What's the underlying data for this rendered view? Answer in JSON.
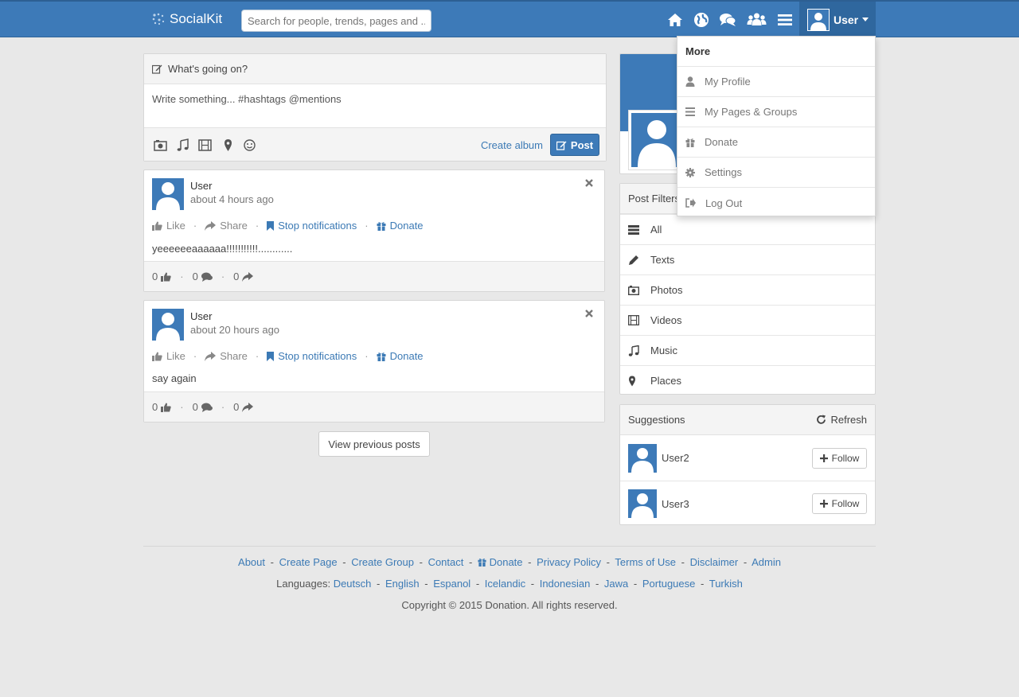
{
  "header": {
    "logo_text": "SocialKit",
    "search_placeholder": "Search for people, trends, pages and ...",
    "user_label": "User",
    "brand_color": "#3d7ab8"
  },
  "user_menu": {
    "title": "More",
    "items": [
      {
        "label": "My Profile",
        "icon": "user-icon"
      },
      {
        "label": "My Pages & Groups",
        "icon": "list-icon"
      },
      {
        "label": "Donate",
        "icon": "gift-icon"
      },
      {
        "label": "Settings",
        "icon": "gear-icon"
      },
      {
        "label": "Log Out",
        "icon": "logout-icon"
      }
    ]
  },
  "composer": {
    "title": "What's going on?",
    "placeholder": "Write something... #hashtags @mentions",
    "create_album": "Create album",
    "post_button": "Post"
  },
  "posts": [
    {
      "name": "User",
      "time": "about 4 hours ago",
      "text": "yeeeeeeaaaaaa!!!!!!!!!!!............",
      "likes": "0",
      "comments": "0",
      "shares": "0"
    },
    {
      "name": "User",
      "time": "about 20 hours ago",
      "text": "say again",
      "likes": "0",
      "comments": "0",
      "shares": "0"
    }
  ],
  "post_actions": {
    "like": "Like",
    "share": "Share",
    "stop_notifications": "Stop notifications",
    "donate": "Donate",
    "separator": "·"
  },
  "view_previous": "View previous posts",
  "filters": {
    "title": "Post Filters",
    "items": [
      {
        "label": "All",
        "icon": "stack-icon"
      },
      {
        "label": "Texts",
        "icon": "pencil-icon"
      },
      {
        "label": "Photos",
        "icon": "camera-icon"
      },
      {
        "label": "Videos",
        "icon": "film-icon"
      },
      {
        "label": "Music",
        "icon": "music-icon"
      },
      {
        "label": "Places",
        "icon": "map-marker-icon"
      }
    ]
  },
  "suggestions": {
    "title": "Suggestions",
    "refresh": "Refresh",
    "follow_label": "Follow",
    "users": [
      "User2",
      "User3"
    ]
  },
  "footer": {
    "links": [
      "About",
      "Create Page",
      "Create Group",
      "Contact",
      "Donate",
      "Privacy Policy",
      "Terms of Use",
      "Disclaimer",
      "Admin"
    ],
    "languages_label": "Languages:",
    "languages": [
      "Deutsch",
      "English",
      "Espanol",
      "Icelandic",
      "Indonesian",
      "Jawa",
      "Portuguese",
      "Turkish"
    ],
    "separator": "-",
    "copyright": "Copyright © 2015 Donation. All rights reserved."
  }
}
